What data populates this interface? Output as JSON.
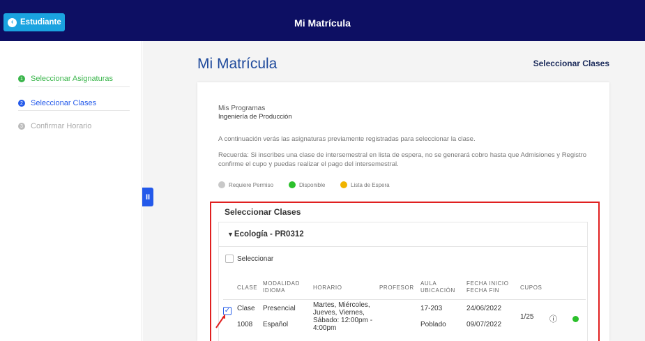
{
  "header": {
    "back_button_label": "Estudiante",
    "title": "Mi Matrícula"
  },
  "sidebar": {
    "steps": [
      {
        "number": "1",
        "label": "Seleccionar Asignaturas"
      },
      {
        "number": "2",
        "label": "Seleccionar Clases"
      },
      {
        "number": "3",
        "label": "Confirmar Horario"
      }
    ],
    "colors": {
      "done": "#39b54a",
      "active": "#2359ea",
      "pending": "#bbbbbb"
    }
  },
  "main": {
    "page_title": "Mi Matrícula",
    "current_step_label": "Seleccionar Clases",
    "programs_label": "Mis Programas",
    "program_name": "Ingeniería de Producción",
    "info_text": "A continuación verás las asignaturas previamente registradas para seleccionar la clase.",
    "reminder_text": "Recuerda: Si inscribes una clase de intersemestral en lista de espera, no se generará cobro hasta que Admisiones y Registro confirme el cupo y puedas realizar el pago del intersemestral.",
    "legend": [
      {
        "label": "Requiere Permiso",
        "color": "#c8c8c8"
      },
      {
        "label": "Disponible",
        "color": "#2bc02b"
      },
      {
        "label": "Lista de Espera",
        "color": "#f0b400"
      }
    ]
  },
  "classes_section": {
    "title": "Seleccionar Clases",
    "course": "Ecología - PR0312",
    "select_label": "Seleccionar",
    "columns": {
      "clase": "CLASE",
      "modalidad": "MODALIDAD",
      "idioma": "IDIOMA",
      "horario": "HORARIO",
      "profesor": "PROFESOR",
      "aula": "AULA",
      "ubicacion": "UBICACIÓN",
      "fecha_inicio": "FECHA INICIO",
      "fecha_fin": "FECHA FIN",
      "cupos": "CUPOS"
    },
    "row": {
      "clase_label": "Clase",
      "clase_number": "1008",
      "modalidad": "Presencial",
      "idioma": "Español",
      "horario": "Martes, Miércoles, Jueves, Viernes, Sábado: 12:00pm - 4:00pm",
      "aula": "17-203",
      "ubicacion": "Poblado",
      "fecha_inicio": "24/06/2022",
      "fecha_fin": "09/07/2022",
      "cupos": "1/25",
      "status_color": "#2bc02b",
      "checked": true
    }
  },
  "annotation_colors": {
    "highlight_box": "#e02020"
  }
}
